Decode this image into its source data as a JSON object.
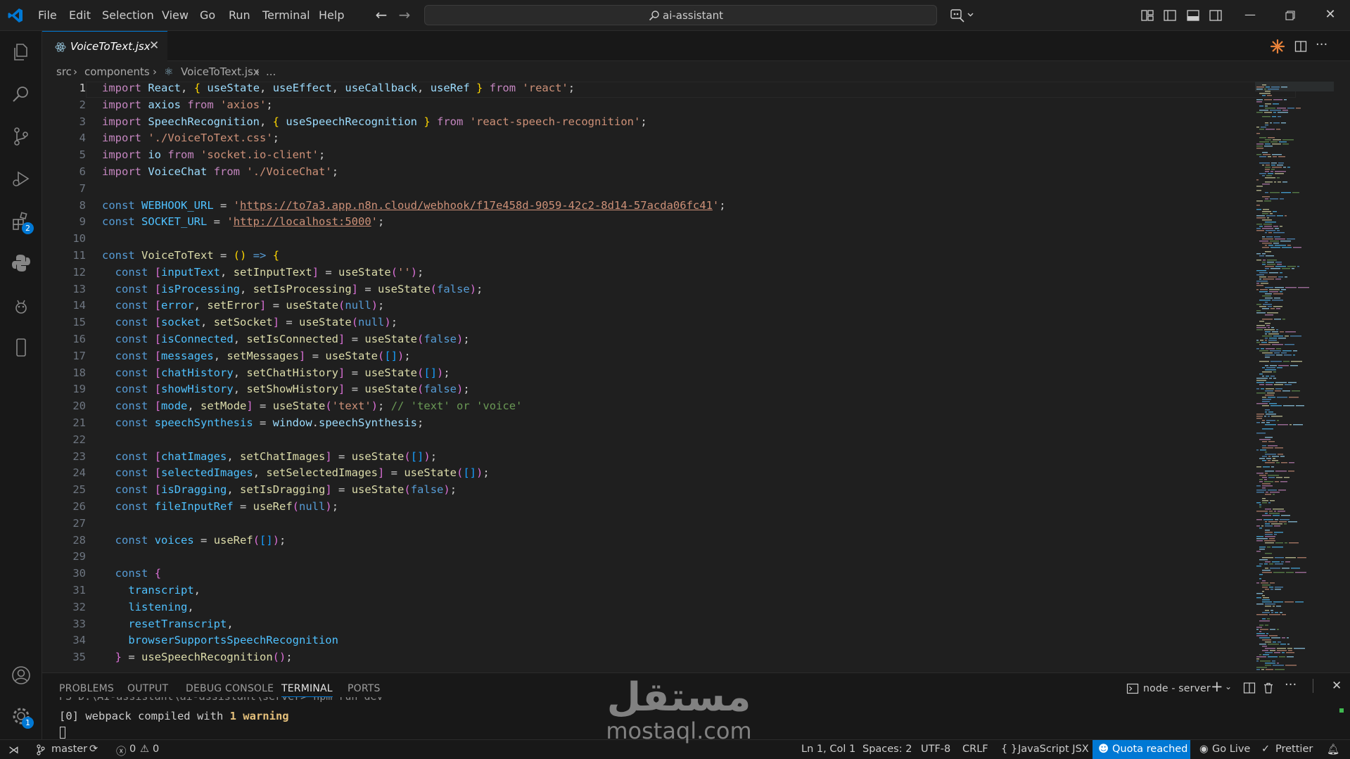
{
  "menu": [
    "File",
    "Edit",
    "Selection",
    "View",
    "Go",
    "Run",
    "Terminal",
    "Help"
  ],
  "search": {
    "text": "ai-assistant"
  },
  "tab": {
    "label": "VoiceToText.jsx"
  },
  "breadcrumb": {
    "src": "src",
    "components": "components",
    "file": "VoiceToText.jsx",
    "more": "..."
  },
  "activity": {
    "extensions_badge": "2",
    "settings_badge": "1"
  },
  "editor": {
    "line_numbers": [
      "1",
      "2",
      "3",
      "4",
      "5",
      "6",
      "7",
      "8",
      "9",
      "10",
      "11",
      "12",
      "13",
      "14",
      "15",
      "16",
      "17",
      "18",
      "19",
      "20",
      "21",
      "22",
      "23",
      "24",
      "25",
      "26",
      "27",
      "28",
      "29",
      "30",
      "31",
      "32",
      "33",
      "34",
      "35"
    ]
  },
  "panel": {
    "tabs": [
      "PROBLEMS",
      "OUTPUT",
      "DEBUG CONSOLE",
      "TERMINAL",
      "PORTS"
    ],
    "active_tab": "TERMINAL",
    "terminal_name": "node - server",
    "output_prefix": "[0] webpack compiled with ",
    "output_bold": "1 warning"
  },
  "statusbar": {
    "branch": "master",
    "errors": "0",
    "warnings": "0",
    "position": "Ln 1, Col 1",
    "spaces": "Spaces: 2",
    "encoding": "UTF-8",
    "eol": "CRLF",
    "language": "JavaScript JSX",
    "quota": "Quota reached",
    "golive": "Go Live",
    "prettier": "Prettier"
  },
  "watermark": {
    "arabic": "مستقل",
    "latin": "mostaql.com"
  },
  "colors": {
    "accent": "#0078d4",
    "background": "#1f1f1f",
    "sidebar": "#181818"
  }
}
